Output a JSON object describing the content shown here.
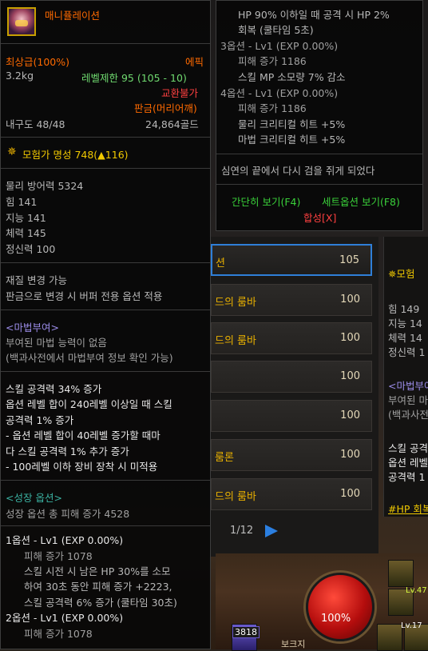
{
  "item": {
    "name": "매니퓰레이션",
    "grade": "최상급(100%)",
    "rarity": "에픽",
    "weight": "3.2kg",
    "level_limit": "레벨제한 95 (105 - 10)",
    "trade": "교환불가",
    "sell_type": "판금(머리어깨)",
    "durability": "내구도 48/48",
    "price": "24,864골드",
    "fame": "모험가 명성 748(▲116)",
    "stats": [
      "물리 방어력 5324",
      "힘 141",
      "지능 141",
      "체력 145",
      "정신력 100"
    ],
    "material_change": [
      "재질 변경 가능",
      "판금으로 변경 시 버퍼 전용 옵션 적용"
    ],
    "magic_enchant": {
      "title": "<마법부여>",
      "lines": [
        "부여된 마법 능력이 없음",
        "(백과사전에서 마법부여 정보 확인 가능)"
      ]
    },
    "skill_options": [
      "스킬 공격력 34% 증가",
      "옵션 레벨 합이 240레벨 이상일 때 스킬",
      "공격력 1% 증가",
      "- 옵션 레벨 합이 40레벨 증가할 때마",
      "다 스킬 공격력 1% 추가 증가",
      "- 100레벨 이하 장비 장착 시 미적용"
    ],
    "growth": {
      "title": "<성장 옵션>",
      "total": "성장 옵션 총 피해 증가 4528",
      "opt1_header": "1옵션 - Lv1 (EXP 0.00%)",
      "opt1_lines": [
        "피해 증가 1078",
        "스킬 시전 시 남은 HP 30%를 소모",
        "하여 30초 동안 피해 증가 +2223,",
        "스킬 공격력 6% 증가 (쿨타임 30초)"
      ],
      "opt2_header": "2옵션 - Lv1 (EXP 0.00%)",
      "opt2_line": "피해 증가 1078"
    }
  },
  "tooltip2": {
    "hp_lines": [
      "HP 90% 이하일 때 공격 시 HP 2%",
      "회복 (쿨타임 5초)"
    ],
    "opt3_header": "3옵션 - Lv1 (EXP 0.00%)",
    "opt3_lines": [
      "피해 증가 1186",
      "스킬 MP 소모량 7% 감소"
    ],
    "opt4_header": "4옵션 - Lv1 (EXP 0.00%)",
    "opt4_lines": [
      "피해 증가 1186",
      "물리 크리티컬 히트 +5%",
      "마법 크리티컬 히트 +5%"
    ],
    "flavor": "심연의 끝에서 다시 검을 쥐게 되었다",
    "simple_view": "간단히 보기(F4)",
    "set_view": "세트옵션 보기(F8)",
    "synthesis": "합성[X]"
  },
  "background": {
    "rows": [
      {
        "name": "션",
        "value": "105"
      },
      {
        "name": "드의 룸바",
        "value": "100"
      },
      {
        "name": "드의 룸바",
        "value": "100"
      },
      {
        "name": "",
        "value": "100"
      },
      {
        "name": "",
        "value": "100"
      },
      {
        "name": "룸론",
        "value": "100"
      },
      {
        "name": "드의 룸바",
        "value": "100"
      }
    ],
    "pager": "1/12",
    "right_panel": {
      "fame": "모험",
      "stats": [
        "힘 149",
        "지능 14",
        "체력 14",
        "정신력 1"
      ],
      "magic": "<마법부여",
      "magic_lines": [
        "부여된 마",
        "(백과사전"
      ],
      "skill_lines": [
        "스킬 공격",
        "옵션 레벨",
        "공격력 1"
      ],
      "hp_tag": "#HP 회복"
    },
    "hud": {
      "orb_percent": "100%",
      "slot_number": "3818",
      "lv_label_1": "Lv.47",
      "lv_label_2": "Lv.17",
      "bottom_text": "보크지"
    }
  },
  "colors": {
    "epic": "#ff6a00",
    "level_ok": "#6fd96f",
    "untradeable": "#ff4040",
    "fame": "#f0c800",
    "enchant": "#9b8ce8",
    "growth": "#3ab0a0",
    "view_link": "#3ad13a"
  },
  "icons": [
    "item-icon",
    "fame-medal-icon",
    "pager-next-icon"
  ]
}
